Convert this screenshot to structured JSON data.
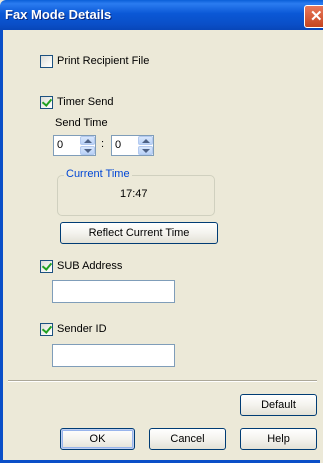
{
  "window": {
    "title": "Fax Mode Details"
  },
  "options": {
    "print_recipient_file": {
      "label": "Print Recipient File",
      "checked": false
    },
    "timer_send": {
      "label": "Timer Send",
      "checked": true
    },
    "sub_address": {
      "label": "SUB Address",
      "checked": true,
      "value": ""
    },
    "sender_id": {
      "label": "Sender ID",
      "checked": true,
      "value": ""
    }
  },
  "send_time": {
    "label": "Send Time",
    "hour": "0",
    "separator": ":",
    "minute": "0"
  },
  "current_time": {
    "legend": "Current Time",
    "value": "17:47",
    "reflect_button": "Reflect Current Time"
  },
  "buttons": {
    "default": "Default",
    "ok": "OK",
    "cancel": "Cancel",
    "help": "Help"
  }
}
